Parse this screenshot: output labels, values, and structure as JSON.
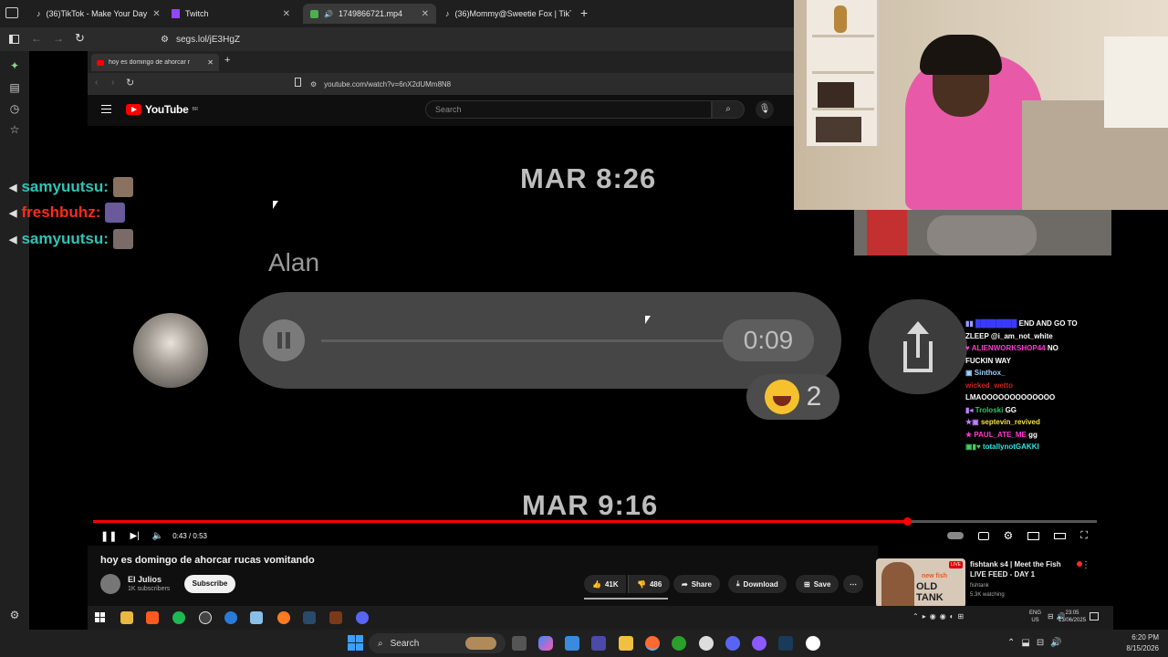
{
  "outer_browser": {
    "tabs": [
      {
        "label": "(36)TikTok - Make Your Day",
        "active": false
      },
      {
        "label": "Twitch",
        "active": false
      },
      {
        "label": "1749866721.mp4",
        "active": true
      },
      {
        "label": "(36)Mommy@Sweetie Fox | TikT",
        "active": false
      }
    ],
    "url": "segs.lol/jE3HgZ"
  },
  "inner_browser": {
    "tab_label": "hoy es domingo de ahorcar r",
    "url": "youtube.com/watch?v=6nX2dUMm8N8"
  },
  "youtube": {
    "logo_text": "YouTube",
    "logo_region": "BR",
    "search_placeholder": "Search"
  },
  "video": {
    "timestamp_top": "MAR 8:26",
    "contact_name": "Alan",
    "voice_duration": "0:09",
    "reaction_count": "2",
    "timestamp_bottom": "MAR 9:16",
    "time_display": "0:43 / 0:53",
    "progress_fraction": 0.811
  },
  "chat_overlay": [
    {
      "user": "samyuutsu:",
      "color": "#2ec4b6"
    },
    {
      "user": "freshbuhz:",
      "color": "#ff2a1a"
    },
    {
      "user": "samyuutsu:",
      "color": "#2ec4b6"
    }
  ],
  "twitch_chat": [
    {
      "user": "",
      "text": "END AND GO TO",
      "user_color": "#3a3aff"
    },
    {
      "user": "",
      "text": "ZLEEP @i_am_not_white",
      "user_color": "#ffffff"
    },
    {
      "user": "ALIENWORKSHOP44",
      "text": "NO",
      "user_color": "#ff3ad0"
    },
    {
      "user": "",
      "text": "FUCKIN WAY",
      "user_color": "#ffffff"
    },
    {
      "user": "Sinthox_",
      "text": "",
      "user_color": "#9ad0ff"
    },
    {
      "user": "wicked_wetto",
      "text": "",
      "user_color": "#cc2020"
    },
    {
      "user": "",
      "text": "LMAOOOOOOOOOOOOO",
      "user_color": "#ffffff"
    },
    {
      "user": "Troloski",
      "text": "GG",
      "user_color": "#2ec46a"
    },
    {
      "user": "septevin_revived",
      "text": "",
      "user_color": "#f7e13a"
    },
    {
      "user": "PAUL_ATE_ME",
      "text": "gg",
      "user_color": "#ff3ad0"
    },
    {
      "user": "totallynotGAKKI",
      "text": "",
      "user_color": "#2ee6e6"
    }
  ],
  "below_video": {
    "title": "hoy es domingo de ahorcar rucas vomitando",
    "channel": "El Julios",
    "subscribers": "1K subscribers",
    "subscribe_label": "Subscribe",
    "likes": "41K",
    "dislikes": "486",
    "share_label": "Share",
    "download_label": "Download",
    "save_label": "Save"
  },
  "recommendation": {
    "title_line1": "fishtank s4 | Meet the Fish",
    "title_line2": "LIVE FEED - DAY 1",
    "channel": "fishtank",
    "watching": "5.3K watching",
    "thumb_text1": "new fish",
    "thumb_text2": "OLD TANK",
    "live_badge": "LIVE"
  },
  "inner_taskbar": {
    "lang1": "ENG",
    "lang2": "US",
    "time": "23:05",
    "date": "13/06/2025"
  },
  "main_taskbar": {
    "search_label": "Search",
    "time": "6:20 PM",
    "date": "8/15/2026"
  }
}
